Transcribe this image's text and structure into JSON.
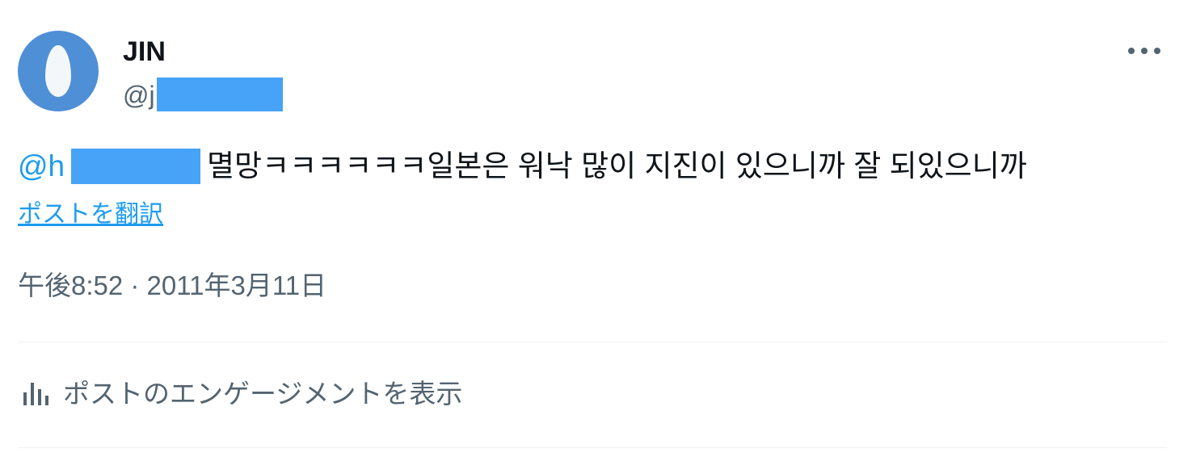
{
  "author": {
    "display_name": "JIN",
    "handle_prefix": "@j"
  },
  "menu": {
    "more_icon": "more-horizontal-icon"
  },
  "tweet": {
    "mention_prefix": "@h",
    "text": "멸망ㅋㅋㅋㅋㅋㅋ일본은 워낙 많이 지진이 있으니까 잘 되있으니까",
    "translate_label": "ポストを翻訳",
    "timestamp": "午後8:52 · 2011年3月11日"
  },
  "engagement": {
    "icon": "analytics-bar-icon",
    "label": "ポストのエンゲージメントを表示"
  },
  "colors": {
    "accent": "#1d9bf0",
    "redaction": "#47a3f7",
    "avatar_bg": "#4f8fd6",
    "secondary_text": "#536471"
  }
}
